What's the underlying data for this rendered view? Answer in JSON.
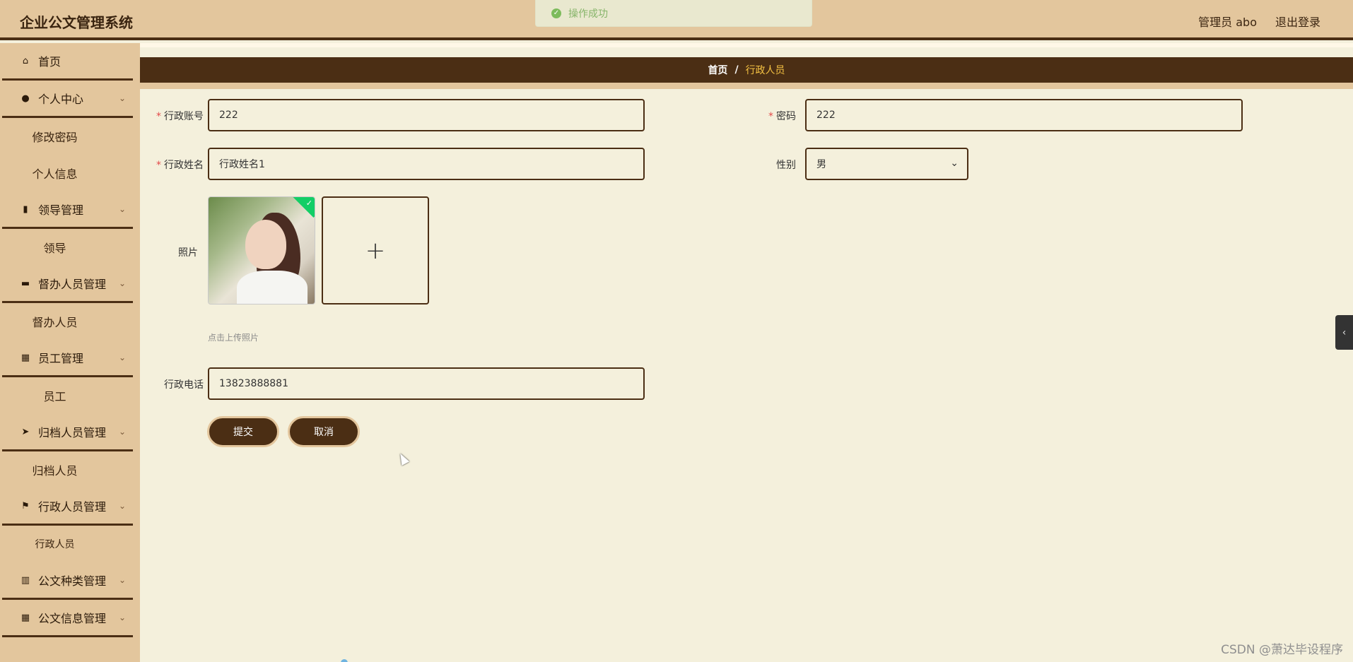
{
  "header": {
    "app_title": "企业公文管理系统",
    "user_label": "管理员 abo",
    "logout_label": "退出登录"
  },
  "toast": {
    "message": "操作成功",
    "icon": "success-check-icon"
  },
  "sidebar": {
    "items": [
      {
        "label": "首页",
        "icon": "home-icon"
      },
      {
        "label": "个人中心",
        "icon": "user-icon",
        "sub": [
          "修改密码",
          "个人信息"
        ]
      },
      {
        "label": "领导管理",
        "icon": "book-icon",
        "sub": [
          "领导"
        ]
      },
      {
        "label": "督办人员管理",
        "icon": "briefcase-icon",
        "sub": [
          "督办人员"
        ]
      },
      {
        "label": "员工管理",
        "icon": "grid-icon",
        "sub": [
          "员工"
        ]
      },
      {
        "label": "归档人员管理",
        "icon": "paper-plane-icon",
        "sub": [
          "归档人员"
        ]
      },
      {
        "label": "行政人员管理",
        "icon": "flag-icon",
        "sub": [
          "行政人员"
        ]
      },
      {
        "label": "公文种类管理",
        "icon": "bar-chart-icon"
      },
      {
        "label": "公文信息管理",
        "icon": "grid-icon"
      }
    ]
  },
  "breadcrumb": {
    "home": "首页",
    "separator": "/",
    "current": "行政人员"
  },
  "form": {
    "account_label": "行政账号",
    "account_value": "222",
    "password_label": "密码",
    "password_value": "222",
    "name_label": "行政姓名",
    "name_value": "行政姓名1",
    "gender_label": "性别",
    "gender_value": "男",
    "photo_label": "照片",
    "upload_hint": "点击上传照片",
    "phone_label": "行政电话",
    "phone_value": "13823888881",
    "required_mark": "*"
  },
  "buttons": {
    "submit": "提交",
    "cancel": "取消"
  },
  "watermark": "CSDN @萧达毕设程序",
  "colors": {
    "header_bg": "#e3c69d",
    "accent_dark": "#4b2e14",
    "content_bg": "#f4f0dc",
    "breadcrumb_current": "#f6c343"
  }
}
